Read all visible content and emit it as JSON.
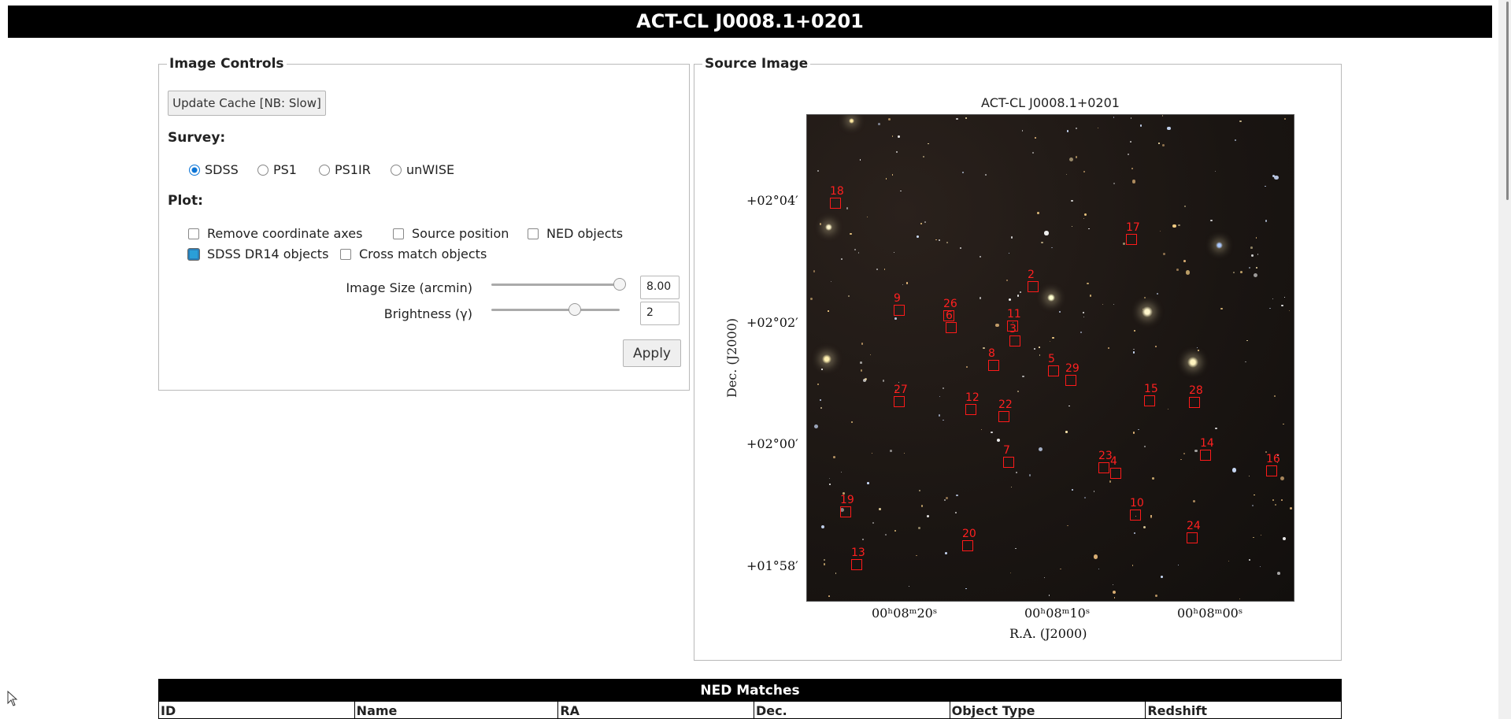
{
  "page": {
    "title": "ACT-CL J0008.1+0201"
  },
  "image_controls": {
    "legend": "Image Controls",
    "update_button": "Update Cache [NB: Slow]",
    "survey_label": "Survey:",
    "surveys": [
      {
        "label": "SDSS",
        "checked": true
      },
      {
        "label": "PS1",
        "checked": false
      },
      {
        "label": "PS1IR",
        "checked": false
      },
      {
        "label": "unWISE",
        "checked": false
      }
    ],
    "plot_label": "Plot:",
    "plot_options": {
      "remove_axes": "Remove coordinate axes",
      "source_position": "Source position",
      "ned_objects": "NED objects",
      "sdss_objects": "SDSS DR14 objects",
      "cross_match": "Cross match objects"
    },
    "image_size": {
      "label": "Image Size (arcmin)",
      "value": "8.00",
      "level": 1.0
    },
    "brightness": {
      "label": "Brightness (γ)",
      "value": "2",
      "level": 0.65
    },
    "apply_button": "Apply"
  },
  "source_image": {
    "legend": "Source Image",
    "plot_title": "ACT-CL J0008.1+0201",
    "y_axis_label": "Dec. (J2000)",
    "x_axis_label": "R.A. (J2000)",
    "y_ticks": [
      "+02°04′",
      "+02°02′",
      "+02°00′",
      "+01°58′"
    ],
    "x_ticks": [
      "00ʰ08ᵐ20ˢ",
      "00ʰ08ᵐ10ˢ",
      "00ʰ08ᵐ00ˢ"
    ],
    "markers": [
      "18",
      "17",
      "2",
      "9",
      "26",
      "6",
      "11",
      "3",
      "8",
      "29",
      "5",
      "27",
      "12",
      "22",
      "15",
      "28",
      "7",
      "23",
      "4",
      "14",
      "16",
      "19",
      "10",
      "20",
      "24",
      "13"
    ],
    "colors": {
      "marker": "#ff1a1a",
      "background": "#1a1512"
    }
  },
  "ned_matches": {
    "title": "NED Matches",
    "columns": [
      "ID",
      "Name",
      "RA",
      "Dec.",
      "Object Type",
      "Redshift"
    ]
  }
}
